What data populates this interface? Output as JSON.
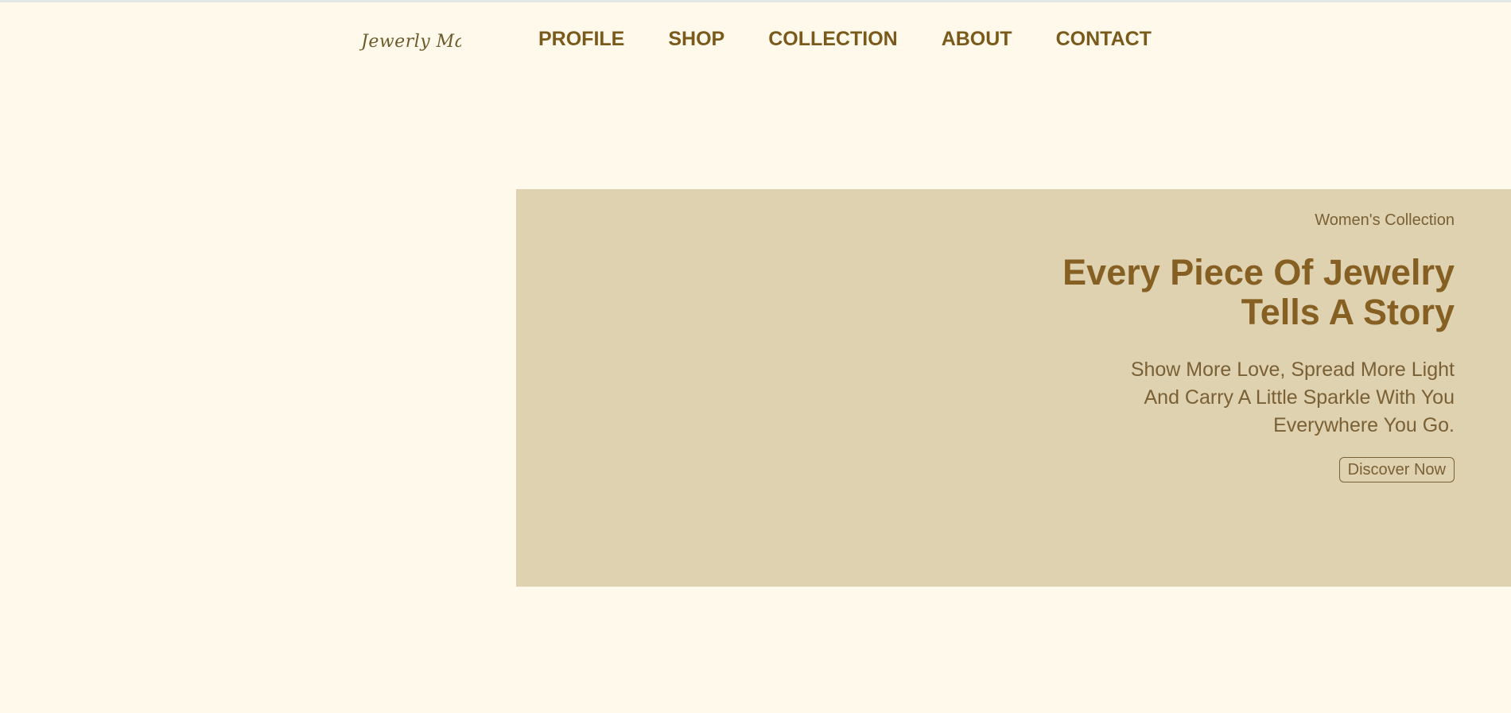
{
  "header": {
    "logo": "Jewerly Mall",
    "nav": [
      "PROFILE",
      "SHOP",
      "COLLECTION",
      "ABOUT",
      "CONTACT"
    ]
  },
  "hero": {
    "eyebrow": "Women's Collection",
    "headline_line1": "Every Piece Of Jewelry",
    "headline_line2": "Tells A Story",
    "subtext_line1": "Show More Love, Spread More Light",
    "subtext_line2": "And Carry A Little Sparkle With You",
    "subtext_line3": "Everywhere You Go.",
    "cta_label": "Discover Now"
  },
  "colors": {
    "page_background": "#fff9ec",
    "hero_background": "#dfd2b0",
    "brand_brown": "#865f22",
    "text_muted_brown": "#7a6035"
  }
}
